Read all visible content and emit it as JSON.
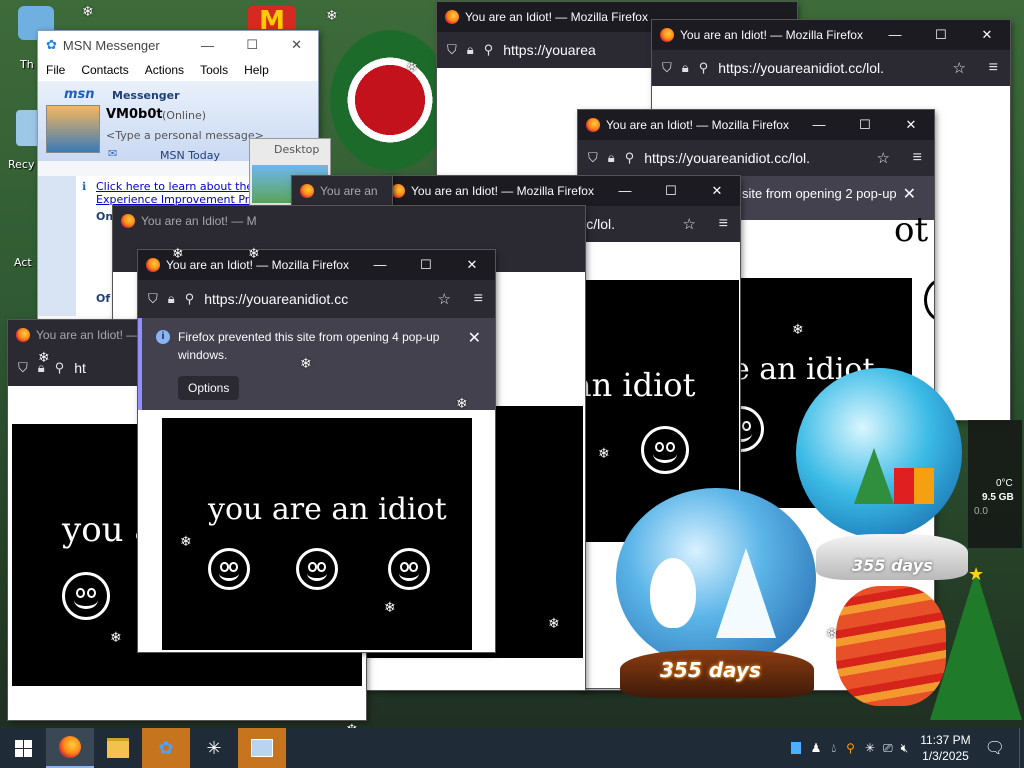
{
  "desktop": {
    "icon_labels": [
      "Th",
      "Recy",
      "Act"
    ],
    "desktop_window_label": "Desktop"
  },
  "msn": {
    "title": "MSN Messenger",
    "menu": [
      "File",
      "Contacts",
      "Actions",
      "Tools",
      "Help"
    ],
    "brand": "msn",
    "brand_sub": "Messenger",
    "username": "VM0b0t",
    "status": "(Online)",
    "personal_message": "<Type a personal message>",
    "msn_today": "MSN Today",
    "info_link_1": "Click here to learn about the Cu",
    "info_link_2": "Experience Improvement Progra",
    "group_online": "On",
    "group_offline": "Of"
  },
  "firefox": {
    "window_title": "You are an Idiot! — Mozilla Firefox",
    "window_title_short": "You are an",
    "window_title_short2": "You are an Idiot! — M",
    "url_full": "https://youareanidiot.cc/lol.",
    "url_short": "https://youarea",
    "url_mid": "https://youareanidiot.cc",
    "url_cut": "https://youareanidiot.cc",
    "url_tiny": "ht",
    "notif_main": "Firefox prevented this site from opening 4 pop-up windows.",
    "notif_side": "site from opening 2 pop-up",
    "options_label": "Options"
  },
  "idiot": {
    "text": "you are an idiot",
    "text_partial_1": "you a",
    "text_partial_2": "are an idiot",
    "text_partial_3": "e an idiot",
    "text_partial_4": "ot"
  },
  "globes": {
    "days_label_1": "355 days",
    "days_label_2": "355 days"
  },
  "taskbar": {
    "time": "11:37 PM",
    "date": "1/3/2025"
  },
  "gadget": {
    "temp": "0°C",
    "mem": "9.5 GB",
    "val": "0.0"
  },
  "icons": [
    "windows-start-icon",
    "firefox-icon",
    "file-explorer-icon",
    "msn-icon",
    "snowflake-icon",
    "weather-icon"
  ]
}
